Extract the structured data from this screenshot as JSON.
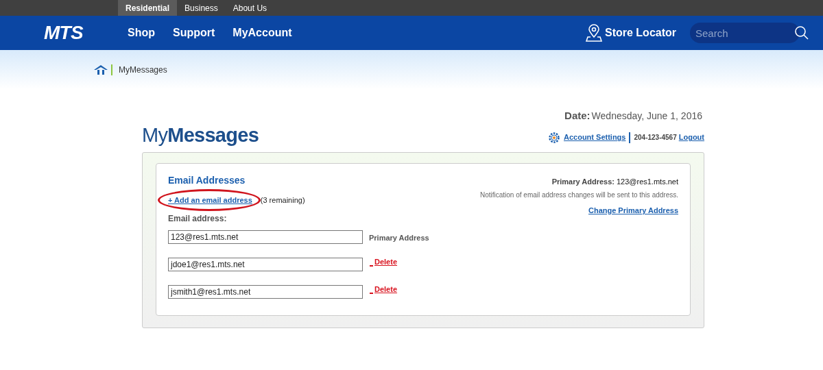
{
  "top_tabs": [
    {
      "label": "Residential",
      "selected": true
    },
    {
      "label": "Business",
      "selected": false
    },
    {
      "label": "About Us",
      "selected": false
    }
  ],
  "nav": {
    "logo": "MTS",
    "items": [
      "Shop",
      "Support",
      "MyAccount"
    ],
    "store_locator": "Store Locator",
    "search": {
      "placeholder": "Search"
    }
  },
  "breadcrumb": "MyMessages",
  "date": {
    "label": "Date:",
    "value": "Wednesday, June 1, 2016"
  },
  "title": "My**Messages**",
  "account": {
    "settings": "Account Settings",
    "phone": "204-123-4567",
    "logout": "Logout"
  },
  "panel": {
    "heading": "Email Addresses",
    "add_link": "+ Add an email address",
    "remaining": "(3 remaining)",
    "field_label": "Email address:",
    "highlighted": true,
    "primary": {
      "label": "Primary Address:",
      "value": "123@res1.mts.net",
      "note": "Notification of email address changes will be sent to this address.",
      "change_link": "Change Primary Address"
    },
    "emails": [
      {
        "value": "123@res1.mts.net",
        "kind": "primary",
        "note": "Primary Address"
      },
      {
        "value": "jdoe1@res1.mts.net",
        "kind": "delete",
        "note": "Delete"
      },
      {
        "value": "jsmith1@res1.mts.net",
        "kind": "delete",
        "note": "Delete"
      }
    ]
  }
}
